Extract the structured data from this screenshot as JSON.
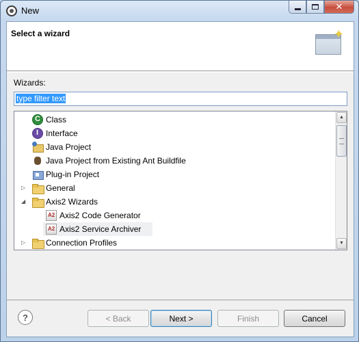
{
  "window": {
    "title": "New",
    "icon": "eclipse-app-icon",
    "controls": {
      "minimize": "minimize",
      "maximize": "maximize",
      "close": "✕"
    }
  },
  "header": {
    "title": "Select a wizard",
    "banner_icon": "new-wizard-banner-icon"
  },
  "filter": {
    "label": "Wizards:",
    "value": "type filter text"
  },
  "tree": {
    "items": [
      {
        "label": "Class",
        "icon": "class-icon",
        "level": 1,
        "expandable": false
      },
      {
        "label": "Interface",
        "icon": "interface-icon",
        "level": 1,
        "expandable": false
      },
      {
        "label": "Java Project",
        "icon": "java-project-icon",
        "level": 1,
        "expandable": false
      },
      {
        "label": "Java Project from Existing Ant Buildfile",
        "icon": "ant-project-icon",
        "level": 1,
        "expandable": false
      },
      {
        "label": "Plug-in Project",
        "icon": "plugin-project-icon",
        "level": 1,
        "expandable": false
      },
      {
        "label": "General",
        "icon": "folder-icon",
        "level": 0,
        "expandable": true,
        "expanded": false
      },
      {
        "label": "Axis2 Wizards",
        "icon": "folder-icon",
        "level": 0,
        "expandable": true,
        "expanded": true
      },
      {
        "label": "Axis2 Code Generator",
        "icon": "axis2-wizard-icon",
        "level": 1,
        "expandable": false
      },
      {
        "label": "Axis2 Service Archiver",
        "icon": "axis2-wizard-icon",
        "level": 1,
        "expandable": false,
        "selected": true
      },
      {
        "label": "Connection Profiles",
        "icon": "folder-icon",
        "level": 0,
        "expandable": true,
        "expanded": false
      }
    ]
  },
  "buttons": {
    "help": "?",
    "back": "< Back",
    "next": "Next >",
    "finish": "Finish",
    "cancel": "Cancel"
  },
  "colors": {
    "selection_highlight": "#3399ff",
    "default_button_border": "#3c7fb1"
  }
}
